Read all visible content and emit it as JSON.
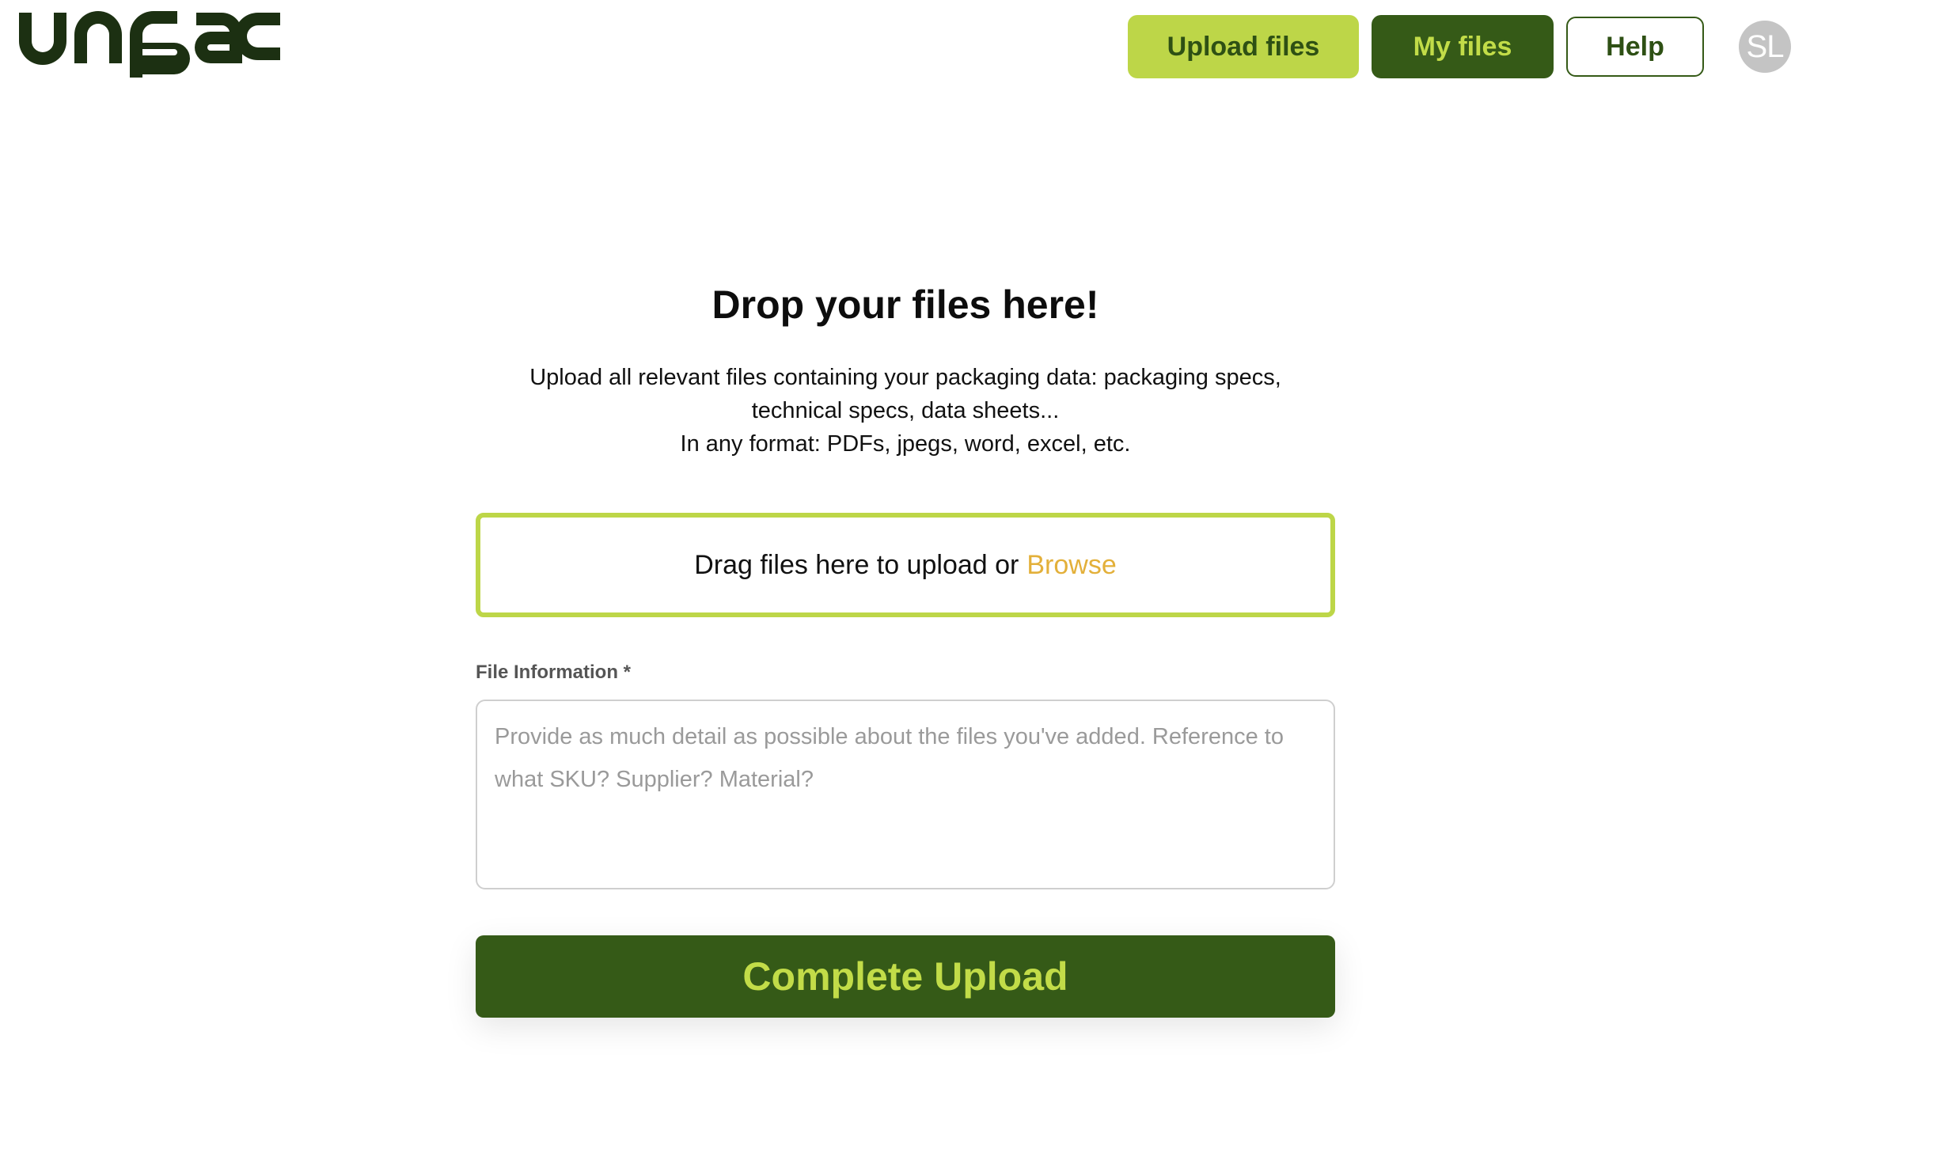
{
  "brand": {
    "name": "unpac",
    "logo_color": "#1c3012"
  },
  "nav": {
    "upload_files": "Upload files",
    "my_files": "My files",
    "help": "Help",
    "avatar_initials": "SL"
  },
  "main": {
    "title": "Drop your files here!",
    "description_line1": "Upload all relevant files containing your packaging data: packaging specs,",
    "description_line2": "technical specs, data sheets...",
    "description_line3": "In any format: PDFs, jpegs, word, excel, etc.",
    "dropzone_text": "Drag files here to upload or",
    "browse_link": "Browse",
    "file_info_label": "File Information *",
    "file_info_placeholder": "Provide as much detail as possible about the files you've added. Reference to what SKU? Supplier? Material?",
    "file_info_value": "",
    "complete_button": "Complete Upload"
  },
  "colors": {
    "accent_lime": "#bdd648",
    "dark_green": "#355a17",
    "browse_gold": "#e3b03a",
    "avatar_gray": "#c4c4c4"
  }
}
